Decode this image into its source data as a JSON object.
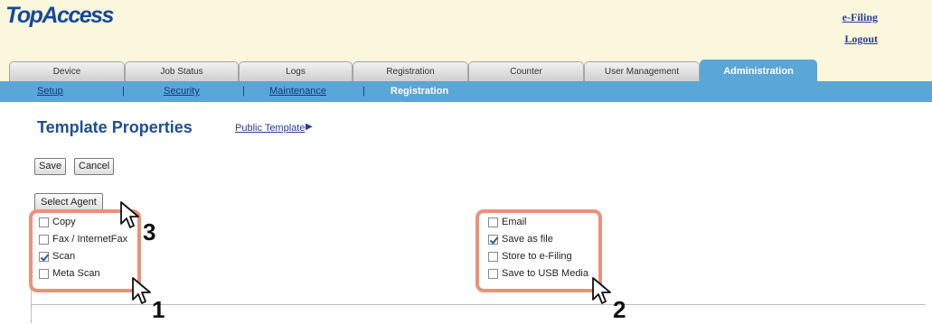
{
  "app": {
    "logo": "TopAccess",
    "links": {
      "efiling": "e-Filing",
      "logout": "Logout"
    }
  },
  "tabs": [
    {
      "label": "Device"
    },
    {
      "label": "Job Status"
    },
    {
      "label": "Logs"
    },
    {
      "label": "Registration"
    },
    {
      "label": "Counter"
    },
    {
      "label": "User Management"
    },
    {
      "label": "Administration",
      "active": true
    }
  ],
  "subnav": [
    {
      "label": "Setup"
    },
    {
      "label": "Security"
    },
    {
      "label": "Maintenance"
    },
    {
      "label": "Registration",
      "active": true
    }
  ],
  "subnav_separator": "|",
  "page": {
    "title": "Template Properties",
    "breadcrumb": "Public Template",
    "breadcrumb_arrow": "▶"
  },
  "buttons": {
    "save": "Save",
    "cancel": "Cancel",
    "select_agent": "Select Agent"
  },
  "agents_left": [
    {
      "label": "Copy",
      "checked": false
    },
    {
      "label": "Fax / InternetFax",
      "checked": false
    },
    {
      "label": "Scan",
      "checked": true
    },
    {
      "label": "Meta Scan",
      "checked": false
    }
  ],
  "agents_right": [
    {
      "label": "Email",
      "checked": false
    },
    {
      "label": "Save as file",
      "checked": true
    },
    {
      "label": "Store to e-Filing",
      "checked": false
    },
    {
      "label": "Save to USB Media",
      "checked": false
    }
  ],
  "callout_numbers": {
    "one": "1",
    "two": "2",
    "three": "3"
  },
  "colors": {
    "accent": "#5aa6d6",
    "title": "#1e4f8f",
    "callout": "#e8927a",
    "header_bg": "#fbf7dd"
  }
}
